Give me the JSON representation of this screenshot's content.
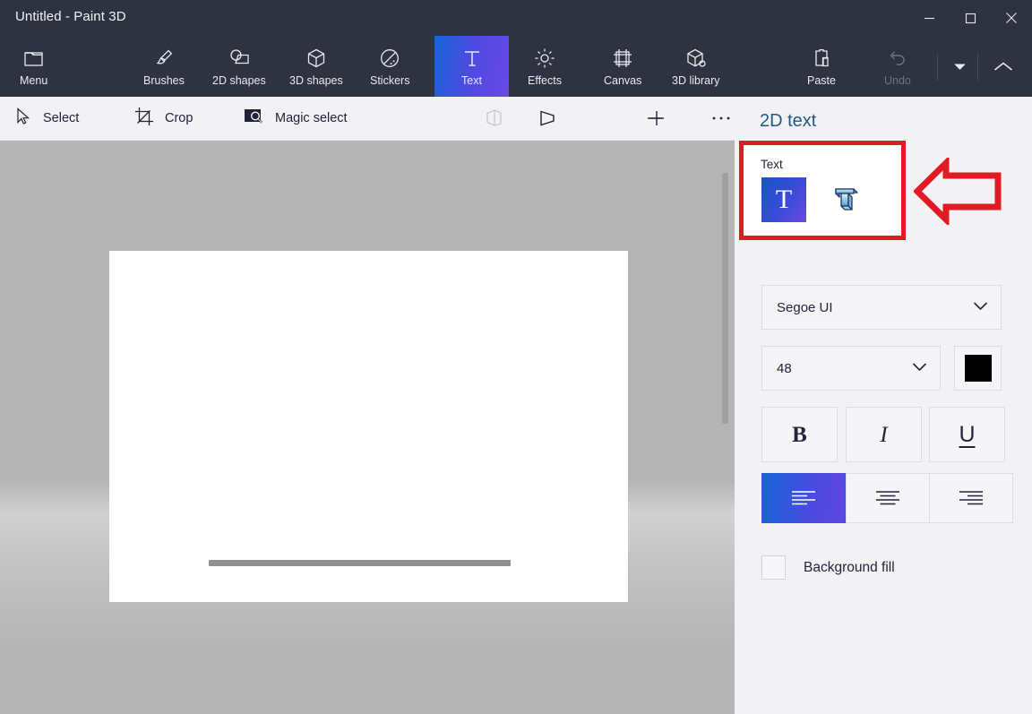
{
  "window": {
    "title": "Untitled - Paint 3D",
    "controls": [
      {
        "name": "minimize",
        "glyph": "minimize-icon"
      },
      {
        "name": "maximize",
        "glyph": "maximize-icon"
      },
      {
        "name": "close",
        "glyph": "close-icon"
      }
    ]
  },
  "ribbon": {
    "tabs": [
      {
        "label": "Menu",
        "icon": "menu-folder-icon",
        "selected": false,
        "disabled": false
      },
      {
        "label": "Brushes",
        "icon": "brush-icon",
        "selected": false,
        "disabled": false
      },
      {
        "label": "2D shapes",
        "icon": "2d-shapes-icon",
        "selected": false,
        "disabled": false
      },
      {
        "label": "3D shapes",
        "icon": "3d-shapes-icon",
        "selected": false,
        "disabled": false
      },
      {
        "label": "Stickers",
        "icon": "stickers-icon",
        "selected": false,
        "disabled": false
      },
      {
        "label": "Text",
        "icon": "text-icon",
        "selected": true,
        "disabled": false
      },
      {
        "label": "Effects",
        "icon": "effects-icon",
        "selected": false,
        "disabled": false
      },
      {
        "label": "Canvas",
        "icon": "canvas-icon",
        "selected": false,
        "disabled": false
      },
      {
        "label": "3D library",
        "icon": "3d-library-icon",
        "selected": false,
        "disabled": false
      },
      {
        "label": "Paste",
        "icon": "paste-icon",
        "selected": false,
        "disabled": false
      },
      {
        "label": "Undo",
        "icon": "undo-icon",
        "selected": false,
        "disabled": true
      }
    ],
    "history_dropdown": "chevron-down-icon",
    "collapse_ribbon": "chevron-up-icon"
  },
  "toolbar": {
    "select_label": "Select",
    "crop_label": "Crop",
    "magic_select_label": "Magic select",
    "view_3d_icon": "3d-view-icon",
    "view_2d_icon": "2d-view-icon",
    "zoom_out_icon": "minus-icon",
    "zoom_in_icon": "plus-icon",
    "more_icon": "ellipsis-icon"
  },
  "panel": {
    "title": "2D text",
    "text_group_label": "Text",
    "text_2d_button": "2D-text-icon",
    "text_3d_button": "3D-text-icon",
    "font_family": "Segoe UI",
    "font_size": "48",
    "color_swatch": "#000000",
    "bold_label": "B",
    "italic_label": "I",
    "underline_label": "U",
    "align_left_icon": "align-left-icon",
    "align_center_icon": "align-center-icon",
    "align_right_icon": "align-right-icon",
    "background_fill_label": "Background fill",
    "background_fill_checked": false
  },
  "annotation": {
    "highlight_color": "#e01b24",
    "arrow_direction": "left"
  },
  "colors": {
    "ribbon_bg": "#2f3341",
    "selected_tab_gradient_start": "#1565d8",
    "selected_tab_gradient_end": "#6b47e6",
    "panel_bg": "#f2f2f4",
    "panel_title": "#1f5b86",
    "canvas_backdrop": "#b5b5b5",
    "artboard": "#ffffff"
  }
}
